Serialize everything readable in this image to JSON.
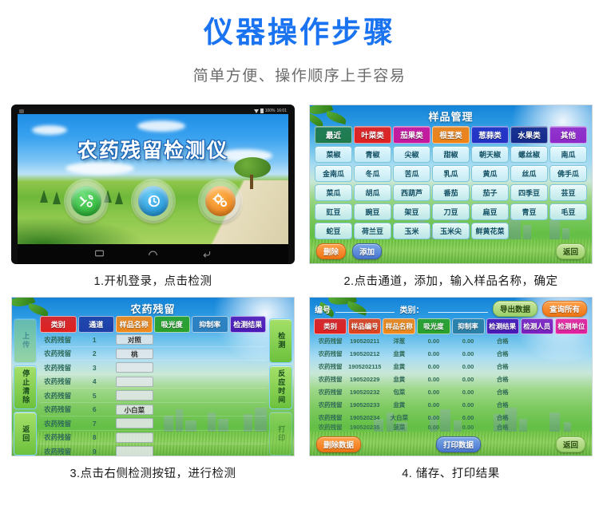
{
  "header": {
    "title": "仪器操作步骤",
    "subtitle": "简单方便、操作顺序上手容易",
    "title_color": "#1a73f0",
    "subtitle_color": "#6b6b6b"
  },
  "panels": [
    {
      "caption": "1.开机登录，点击检测",
      "statusbar": {
        "battery": "100%",
        "time": "16:01"
      },
      "app_name": "农药残留检测仪",
      "icons": [
        {
          "name": "tools-icon",
          "glyph": "🔧",
          "color": "#18a81f"
        },
        {
          "name": "history-clock-icon",
          "glyph": "🕐",
          "color": "#0c86ce"
        },
        {
          "name": "settings-gears-icon",
          "glyph": "⚙",
          "color": "#ed7a10"
        }
      ],
      "navbar": [
        "recents-icon",
        "home-icon",
        "back-icon"
      ]
    },
    {
      "caption": "2.点击通道，添加，输入样品名称，确定",
      "title": "样品管理",
      "tabs": [
        {
          "label": "最近",
          "color": "#1f7a4d"
        },
        {
          "label": "叶菜类",
          "color": "#e02020"
        },
        {
          "label": "茄果类",
          "color": "#c6179c"
        },
        {
          "label": "根茎类",
          "color": "#f08217"
        },
        {
          "label": "葱蒜类",
          "color": "#2331c4"
        },
        {
          "label": "水果类",
          "color": "#142a8c"
        },
        {
          "label": "其他",
          "color": "#8d29c9"
        }
      ],
      "samples": [
        "菜椒",
        "青椒",
        "尖椒",
        "甜椒",
        "朝天椒",
        "螺丝椒",
        "南瓜",
        "金南瓜",
        "冬瓜",
        "苦瓜",
        "乳瓜",
        "黄瓜",
        "丝瓜",
        "佛手瓜",
        "菜瓜",
        "胡瓜",
        "西葫芦",
        "番茄",
        "茄子",
        "四季豆",
        "芸豆",
        "豇豆",
        "豌豆",
        "架豆",
        "刀豆",
        "扁豆",
        "青豆",
        "毛豆",
        "蛇豆",
        "荷兰豆",
        "玉米",
        "玉米尖",
        "鲜黄花菜",
        "",
        ""
      ],
      "buttons": {
        "delete": "删除",
        "add": "添加",
        "back": "返回"
      }
    },
    {
      "caption": "3.点击右侧检测按钮，进行检测",
      "title": "农药残留",
      "left_buttons": [
        {
          "label": "上传",
          "disabled": true
        },
        {
          "label": "停止清除",
          "disabled": false
        },
        {
          "label": "返回",
          "disabled": false
        }
      ],
      "right_buttons": [
        {
          "label": "检测",
          "disabled": false
        },
        {
          "label": "反应时间",
          "disabled": false
        },
        {
          "label": "打印",
          "disabled": true
        }
      ],
      "columns": [
        {
          "label": "类别",
          "color": "#e01f1f"
        },
        {
          "label": "通道",
          "color": "#1c3fa8"
        },
        {
          "label": "样品名称",
          "color": "#f0881a"
        },
        {
          "label": "吸光度",
          "color": "#2aa02a"
        },
        {
          "label": "抑制率",
          "color": "#2a7fbf"
        },
        {
          "label": "检测结果",
          "color": "#4a18b8"
        }
      ],
      "rows": [
        {
          "category": "农药残留",
          "channel": "1",
          "sample": "对照",
          "absorbance": "",
          "inhibition": "",
          "result": ""
        },
        {
          "category": "农药残留",
          "channel": "2",
          "sample": "桃",
          "absorbance": "",
          "inhibition": "",
          "result": ""
        },
        {
          "category": "农药残留",
          "channel": "3",
          "sample": "",
          "absorbance": "",
          "inhibition": "",
          "result": ""
        },
        {
          "category": "农药残留",
          "channel": "4",
          "sample": "",
          "absorbance": "",
          "inhibition": "",
          "result": ""
        },
        {
          "category": "农药残留",
          "channel": "5",
          "sample": "",
          "absorbance": "",
          "inhibition": "",
          "result": ""
        },
        {
          "category": "农药残留",
          "channel": "6",
          "sample": "小白菜",
          "absorbance": "",
          "inhibition": "",
          "result": ""
        },
        {
          "category": "农药残留",
          "channel": "7",
          "sample": "",
          "absorbance": "",
          "inhibition": "",
          "result": ""
        },
        {
          "category": "农药残留",
          "channel": "8",
          "sample": "",
          "absorbance": "",
          "inhibition": "",
          "result": ""
        },
        {
          "category": "农药残留",
          "channel": "9",
          "sample": "",
          "absorbance": "",
          "inhibition": "",
          "result": ""
        }
      ]
    },
    {
      "caption": "4. 储存、打印结果",
      "topbar": {
        "id_label": "编号",
        "category_label": "类别：",
        "export_button": "导出数据",
        "query_button": "查询所有"
      },
      "columns": [
        {
          "label": "类别",
          "color": "#e01f1f"
        },
        {
          "label": "样品编号",
          "color": "#e0431f"
        },
        {
          "label": "样品名称",
          "color": "#f0881a"
        },
        {
          "label": "吸光度",
          "color": "#2aa02a"
        },
        {
          "label": "抑制率",
          "color": "#2a7fa8"
        },
        {
          "label": "检测结果",
          "color": "#4a18b8"
        },
        {
          "label": "检测人员",
          "color": "#7a1fc0"
        },
        {
          "label": "检测单位",
          "color": "#e01f9c"
        }
      ],
      "rows": [
        {
          "category": "农药残留",
          "id": "190520211",
          "sample": "洋葱",
          "absorbance": "0.00",
          "inhibition": "0.00",
          "result": "合格",
          "operator": "",
          "unit": ""
        },
        {
          "category": "农药残留",
          "id": "190520212",
          "sample": "韭黄",
          "absorbance": "0.00",
          "inhibition": "0.00",
          "result": "合格",
          "operator": "",
          "unit": ""
        },
        {
          "category": "农药残留",
          "id": "1905202115",
          "sample": "韭黄",
          "absorbance": "0.00",
          "inhibition": "0.00",
          "result": "合格",
          "operator": "",
          "unit": ""
        },
        {
          "category": "农药残留",
          "id": "190520229",
          "sample": "韭黄",
          "absorbance": "0.00",
          "inhibition": "0.00",
          "result": "合格",
          "operator": "",
          "unit": ""
        },
        {
          "category": "农药残留",
          "id": "190520232",
          "sample": "包菜",
          "absorbance": "0.00",
          "inhibition": "0.00",
          "result": "合格",
          "operator": "",
          "unit": ""
        },
        {
          "category": "农药残留",
          "id": "190520233",
          "sample": "韭黄",
          "absorbance": "0.00",
          "inhibition": "0.00",
          "result": "合格",
          "operator": "",
          "unit": ""
        },
        {
          "category": "农药残留",
          "id": "190520234",
          "sample": "大白菜",
          "absorbance": "0.00",
          "inhibition": "0.00",
          "result": "合格",
          "operator": "",
          "unit": ""
        },
        {
          "category": "农药残留",
          "id": "190520235",
          "sample": "菠菜",
          "absorbance": "0.00",
          "inhibition": "0.00",
          "result": "合格",
          "operator": "",
          "unit": ""
        }
      ],
      "buttons": {
        "delete": "删除数据",
        "print": "打印数据",
        "back": "返回"
      }
    }
  ]
}
